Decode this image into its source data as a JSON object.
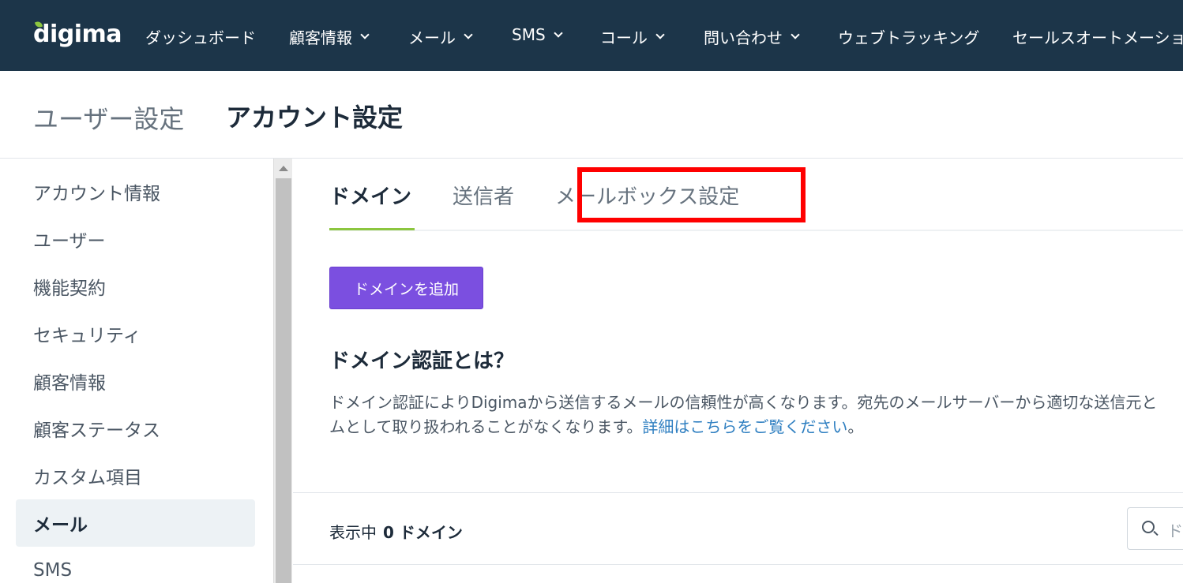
{
  "brand": {
    "logo": "digima",
    "accent": "#8cc63f",
    "nav_bg": "#1c3549"
  },
  "topnav": {
    "items": [
      {
        "label": "ダッシュボード",
        "dropdown": false
      },
      {
        "label": "顧客情報",
        "dropdown": true
      },
      {
        "label": "メール",
        "dropdown": true
      },
      {
        "label": "SMS",
        "dropdown": true
      },
      {
        "label": "コール",
        "dropdown": true
      },
      {
        "label": "問い合わせ",
        "dropdown": true
      },
      {
        "label": "ウェブトラッキング",
        "dropdown": false
      },
      {
        "label": "セールスオートメーショ",
        "dropdown": false
      }
    ]
  },
  "header": {
    "user_settings": "ユーザー設定",
    "account_settings": "アカウント設定"
  },
  "sidebar": {
    "items": [
      {
        "label": "アカウント情報",
        "active": false
      },
      {
        "label": "ユーザー",
        "active": false
      },
      {
        "label": "機能契約",
        "active": false
      },
      {
        "label": "セキュリティ",
        "active": false
      },
      {
        "label": "顧客情報",
        "active": false
      },
      {
        "label": "顧客ステータス",
        "active": false
      },
      {
        "label": "カスタム項目",
        "active": false
      },
      {
        "label": "メール",
        "active": true
      },
      {
        "label": "SMS",
        "active": false
      }
    ]
  },
  "tabs": [
    {
      "label": "ドメイン",
      "active": true
    },
    {
      "label": "送信者",
      "active": false
    },
    {
      "label": "メールボックス設定",
      "active": false,
      "highlighted": true
    }
  ],
  "main": {
    "add_button": "ドメインを追加",
    "section_title": "ドメイン認証とは？",
    "desc_line1": "ドメイン認証によりDigimaから送信するメールの信頼性が高くなります。宛先のメールサーバーから適切な送信元と",
    "desc_line2_prefix": "ムとして取り扱われることがなくなります。",
    "desc_link": "詳細はこちらをご覧ください",
    "desc_line2_suffix": "。",
    "count_label": "表示中",
    "count_value": "0 ドメイン",
    "search_placeholder": "ド"
  },
  "colors": {
    "button": "#7b4fe0",
    "link": "#2f7fc1",
    "highlight": "#ff0000"
  }
}
